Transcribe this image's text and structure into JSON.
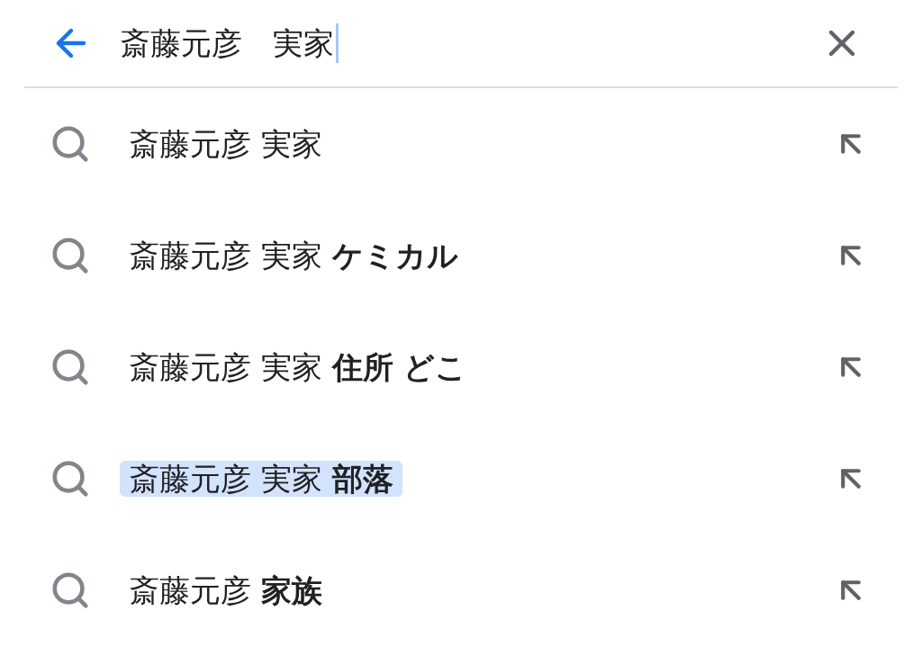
{
  "search_bar": {
    "value": "斎藤元彦　実家"
  },
  "suggestions": [
    {
      "text": "斎藤元彦 実家",
      "highlighted": false
    },
    {
      "text": "斎藤元彦 実家 **ケミカル**",
      "highlighted": false
    },
    {
      "text": "斎藤元彦 実家 **住所 どこ**",
      "highlighted": false
    },
    {
      "text": "斎藤元彦 実家 **部落**",
      "highlighted": true
    },
    {
      "text": "斎藤元彦 **家族**",
      "highlighted": false
    }
  ]
}
